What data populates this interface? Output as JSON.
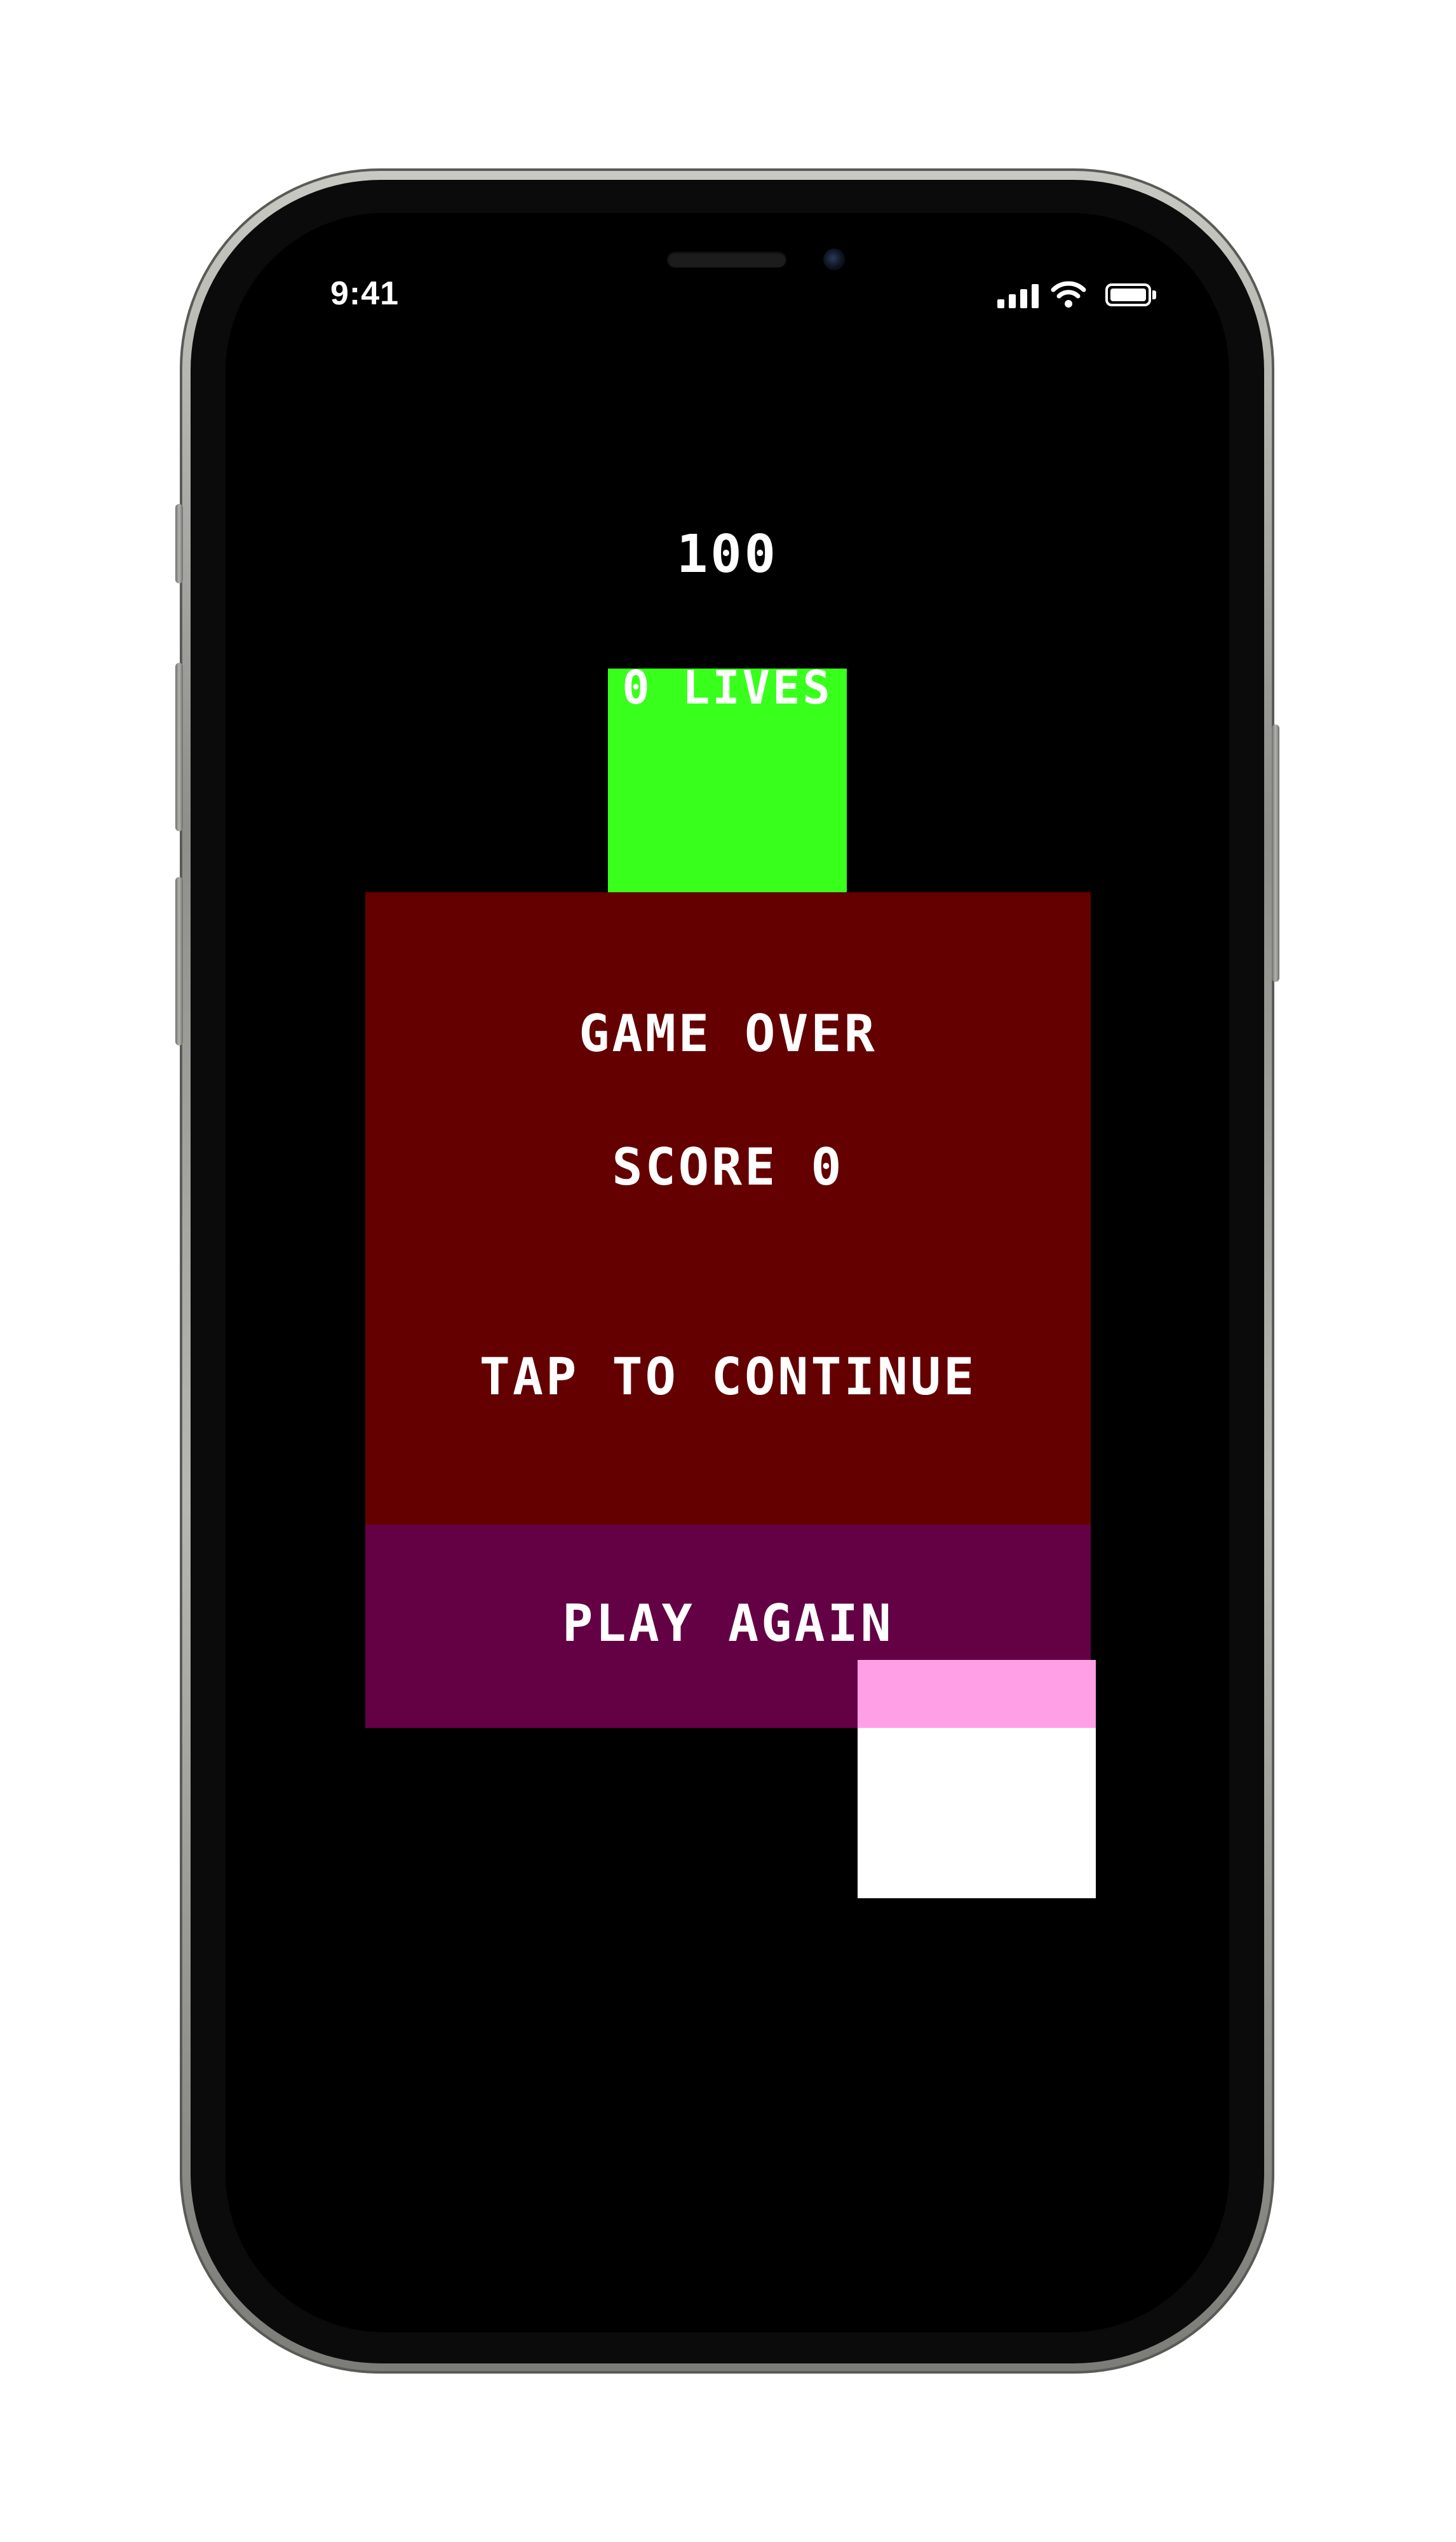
{
  "status_bar": {
    "time": "9:41",
    "signal_icon": "cellular-signal-icon",
    "wifi_icon": "wifi-icon",
    "battery_icon": "battery-icon"
  },
  "game": {
    "top_score": "100",
    "lives_label": "0 LIVES",
    "title": "GAME OVER",
    "score_label": "SCORE 0",
    "tap_label": "TAP TO CONTINUE",
    "play_again_label": "PLAY AGAIN"
  },
  "colors": {
    "background": "#000000",
    "player_block": "#39ff1d",
    "panel": "#640000",
    "play_again_button": "#640044",
    "falling_block": "#ffffff",
    "overlap_highlight": "#ffa0e6"
  }
}
